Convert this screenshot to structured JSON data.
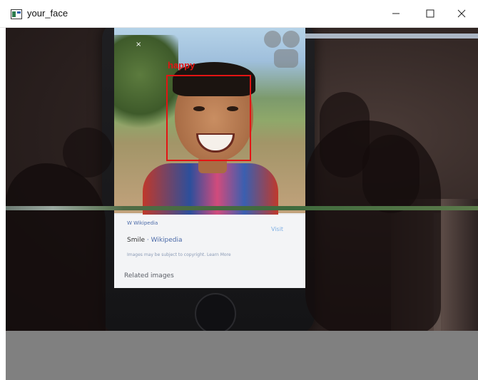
{
  "window": {
    "title": "your_face",
    "controls": {
      "minimize_icon": "minimize-icon",
      "maximize_icon": "maximize-icon",
      "close_icon": "close-icon"
    }
  },
  "detection": {
    "label": "happy",
    "box_color": "#e31414"
  },
  "phone_screen": {
    "close_glyph": "×",
    "wiki_card": {
      "source": "W  Wikipedia",
      "visit": "Visit",
      "title": "Smile",
      "title_sub": "· Wikipedia",
      "note": "Images may be subject to copyright. Learn More",
      "related": "Related images"
    }
  },
  "colors": {
    "bottom_strip": "#808080"
  }
}
